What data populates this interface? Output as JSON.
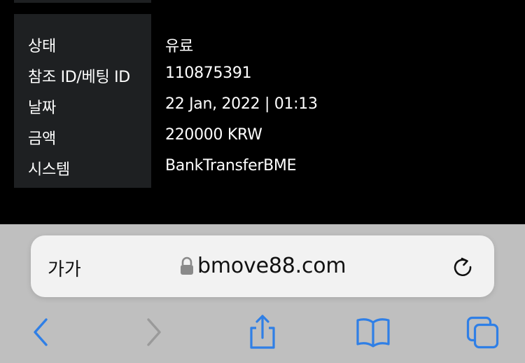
{
  "details": {
    "rows": [
      {
        "label": "상태",
        "value": "유료"
      },
      {
        "label": "참조 ID/베팅 ID",
        "value": "110875391"
      },
      {
        "label": "날짜",
        "value": "22 Jan, 2022 | 01:13"
      },
      {
        "label": "금액",
        "value": "220000 KRW"
      },
      {
        "label": "시스템",
        "value": "BankTransferBME"
      }
    ]
  },
  "browser": {
    "text_size_label": "가가",
    "url": "bmove88.com",
    "accent_color": "#2f7fe6",
    "disabled_color": "#9a9a9a",
    "icons": {
      "lock": "lock-icon",
      "reload": "reload-icon",
      "back": "chevron-left-icon",
      "forward": "chevron-right-icon",
      "share": "share-icon",
      "bookmarks": "book-icon",
      "tabs": "tabs-icon"
    }
  }
}
